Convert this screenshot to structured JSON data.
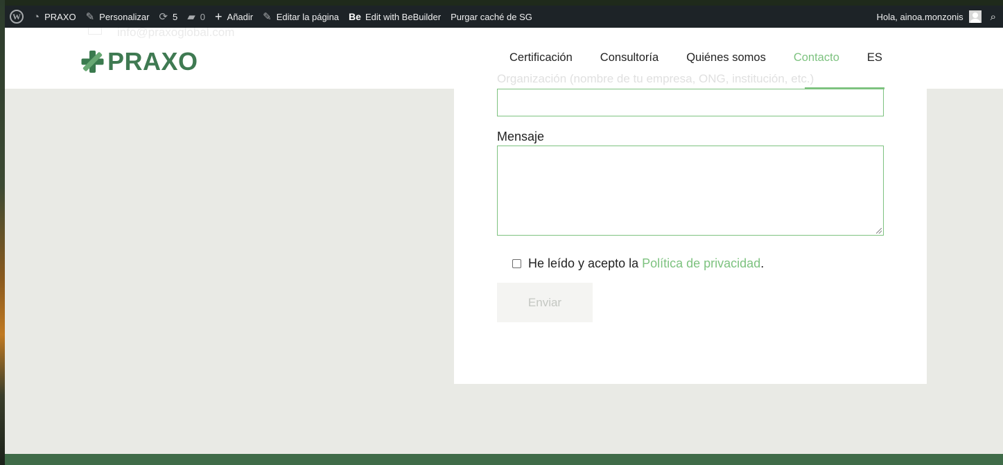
{
  "adminbar": {
    "site_name": "PRAXO",
    "customize": "Personalizar",
    "updates_count": "5",
    "comments_count": "0",
    "new": "Añadir",
    "edit_page": "Editar la página",
    "bebuilder_mark": "Be",
    "bebuilder": "Edit with BeBuilder",
    "purge_cache": "Purgar caché de SG",
    "greeting": "Hola, ainoa.monzonis"
  },
  "header": {
    "logo_text": "PRAXO",
    "ghost_email": "info@praxoglobal.com",
    "nav": [
      {
        "label": "Certificación"
      },
      {
        "label": "Consultoría"
      },
      {
        "label": "Quiénes somos"
      },
      {
        "label": "Contacto",
        "active": true
      },
      {
        "label": "ES"
      }
    ],
    "accent_color": "#7dc27f",
    "brand_color": "#3f7a52"
  },
  "form": {
    "org_label": "Organización (nombre de tu empresa, ONG, institución, etc.)",
    "org_value": "",
    "message_label": "Mensaje",
    "message_value": "",
    "consent_text": "He leído y acepto la",
    "consent_link": "Política de privacidad",
    "consent_suffix": ".",
    "submit_label": "Enviar"
  }
}
